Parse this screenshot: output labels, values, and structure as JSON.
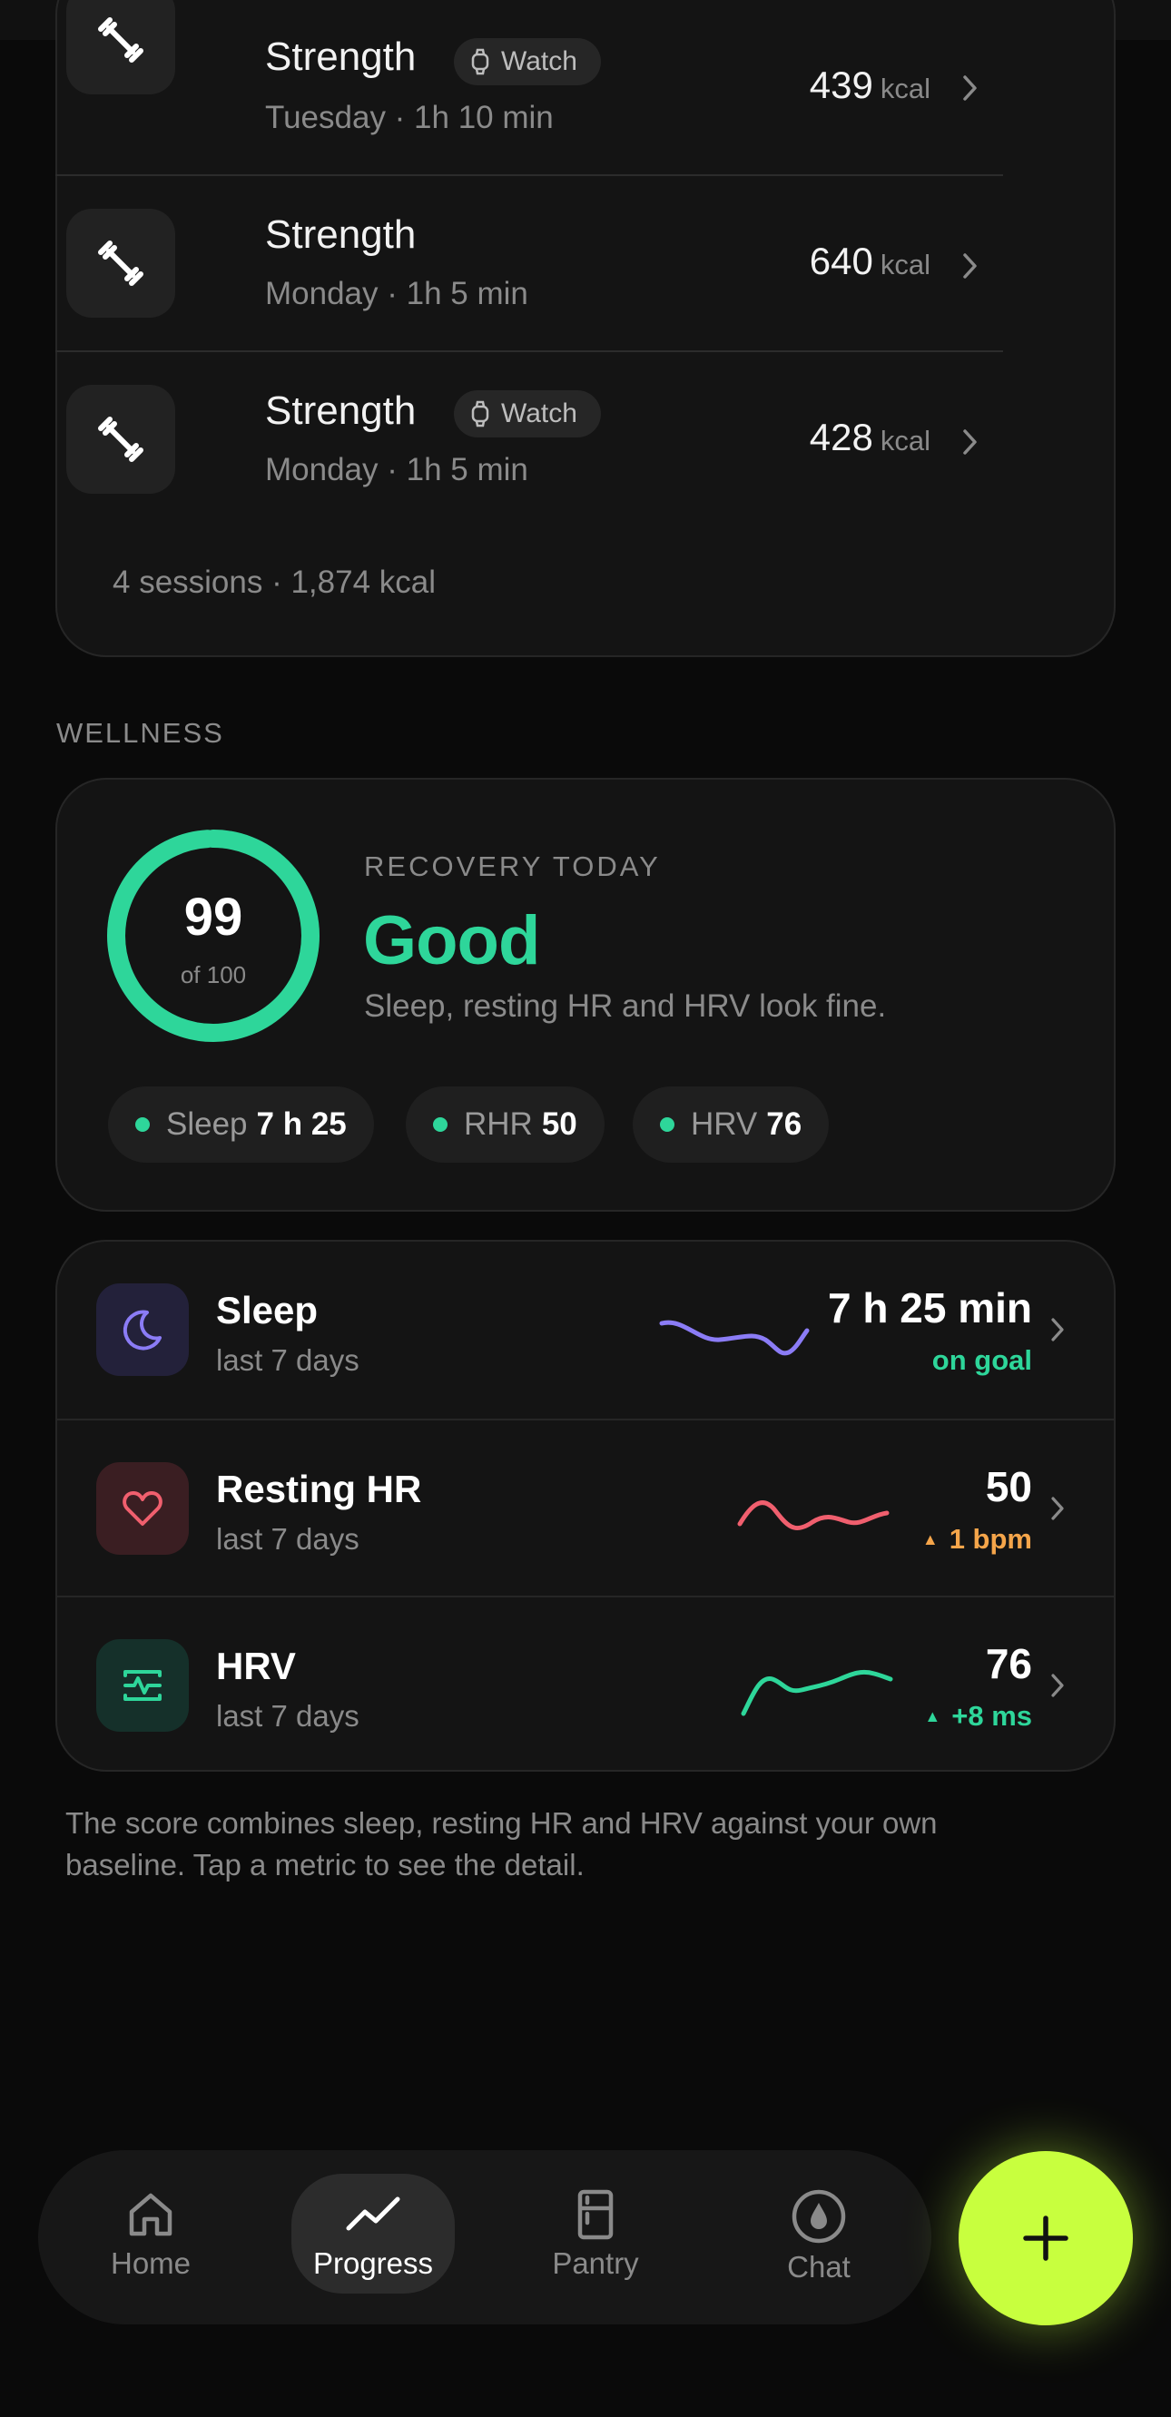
{
  "workouts": {
    "sessions": [
      {
        "title": "Strength",
        "badge": "Watch",
        "subtitle": "Tuesday · 1h 10 min",
        "kcal": "439",
        "unit": "kcal"
      },
      {
        "title": "Strength",
        "badge": "",
        "subtitle": "Monday · 1h 5 min",
        "kcal": "640",
        "unit": "kcal"
      },
      {
        "title": "Strength",
        "badge": "Watch",
        "subtitle": "Monday · 1h 5 min",
        "kcal": "428",
        "unit": "kcal"
      }
    ],
    "summary": "4 sessions · 1,874 kcal",
    "icon": "dumbbell-icon"
  },
  "wellness": {
    "section_label": "WELLNESS",
    "recovery": {
      "score": "99",
      "score_max_label": "of 100",
      "score_fraction": 0.99,
      "label": "RECOVERY TODAY",
      "status": "Good",
      "description": "Sleep, resting HR and HRV look fine.",
      "chips": [
        {
          "label": "Sleep",
          "value": "7 h 25"
        },
        {
          "label": "RHR",
          "value": "50"
        },
        {
          "label": "HRV",
          "value": "76"
        }
      ]
    },
    "metrics": [
      {
        "title": "Sleep",
        "subtitle": "last 7 days",
        "value": "7 h 25 min",
        "delta": "on goal",
        "delta_color": "#2ed69a",
        "spark_color": "#8b7cf6",
        "icon": "moon-icon"
      },
      {
        "title": "Resting HR",
        "subtitle": "last 7 days",
        "value": "50",
        "delta": "1 bpm",
        "delta_color": "#f5a54a",
        "spark_color": "#f05f6e",
        "icon": "heart-icon"
      },
      {
        "title": "HRV",
        "subtitle": "last 7 days",
        "value": "76",
        "delta": "+8 ms",
        "delta_color": "#2ed69a",
        "spark_color": "#2ed69a",
        "icon": "pulse-icon"
      }
    ],
    "footnote": "The score combines sleep, resting HR and HRV against your own baseline. Tap a metric to see the detail."
  },
  "nav": {
    "items": [
      {
        "label": "Home",
        "icon": "home-icon"
      },
      {
        "label": "Progress",
        "icon": "trend-icon"
      },
      {
        "label": "Pantry",
        "icon": "fridge-icon"
      },
      {
        "label": "Chat",
        "icon": "chat-icon"
      }
    ],
    "active": "Progress",
    "fab_icon": "plus-icon"
  },
  "colors": {
    "accent_green": "#2ed69a",
    "fab": "#c8ff3e",
    "card": "#141414",
    "background": "#0a0a0a"
  }
}
